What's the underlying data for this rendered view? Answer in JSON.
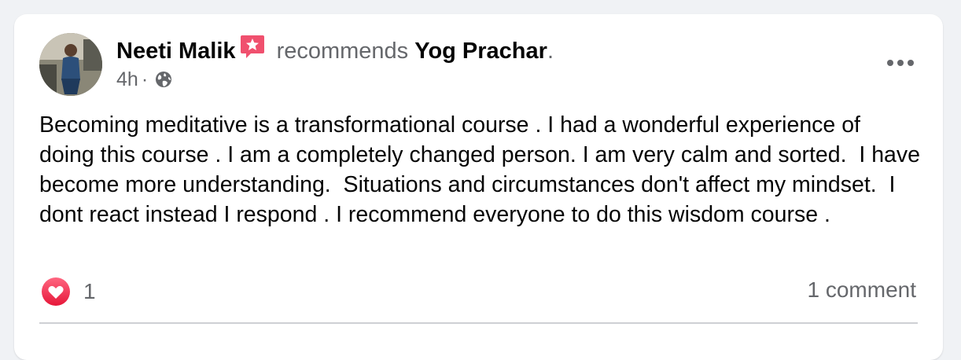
{
  "post": {
    "author": "Neeti Malik",
    "recommend_verb": "recommends",
    "page": "Yog Prachar",
    "page_suffix": ".",
    "time": "4h",
    "separator": "·",
    "privacy_icon": "globe-icon",
    "badge_icon": "recommendation-star-icon",
    "text": "Becoming meditative is a transformational course . I had a wonderful experience of doing this course . I am a completely changed person. I am very calm and sorted.  I have become more understanding.  Situations and circumstances don't affect my mindset.  I dont react instead I respond . I recommend everyone to do this wisdom course ."
  },
  "footer": {
    "reaction_icon": "love-icon",
    "reaction_count": "1",
    "comments": "1 comment"
  },
  "colors": {
    "background": "#f0f2f5",
    "card": "#ffffff",
    "primary_text": "#050505",
    "secondary_text": "#65676b",
    "badge": "#f0506e",
    "love": "#f0284a"
  }
}
